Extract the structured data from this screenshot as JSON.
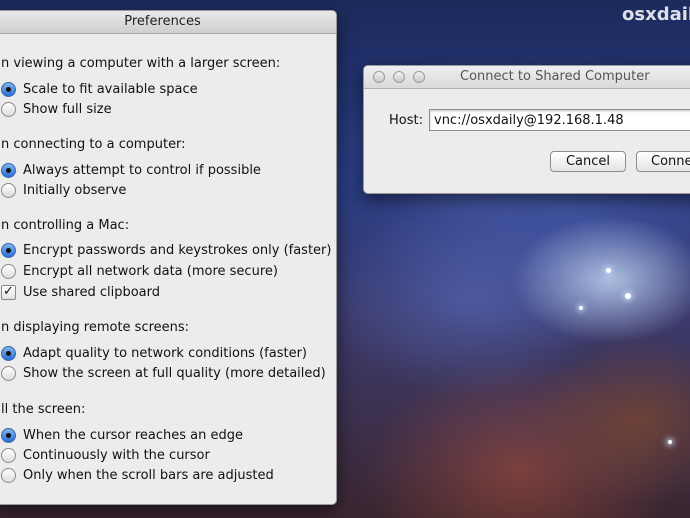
{
  "watermark": "osxdail",
  "preferences": {
    "title": "Preferences",
    "sections": [
      {
        "heading": "n viewing a computer with a larger screen:",
        "options": [
          {
            "label": "Scale to fit available space",
            "type": "radio",
            "checked": true
          },
          {
            "label": "Show full size",
            "type": "radio",
            "checked": false
          }
        ]
      },
      {
        "heading": "n connecting to a computer:",
        "options": [
          {
            "label": "Always attempt to control if possible",
            "type": "radio",
            "checked": true
          },
          {
            "label": "Initially observe",
            "type": "radio",
            "checked": false
          }
        ]
      },
      {
        "heading": "n controlling a Mac:",
        "options": [
          {
            "label": "Encrypt passwords and keystrokes only (faster)",
            "type": "radio",
            "checked": true
          },
          {
            "label": "Encrypt all network data (more secure)",
            "type": "radio",
            "checked": false
          },
          {
            "label": "Use shared clipboard",
            "type": "checkbox",
            "checked": true
          }
        ]
      },
      {
        "heading": "n displaying remote screens:",
        "options": [
          {
            "label": "Adapt quality to network conditions (faster)",
            "type": "radio",
            "checked": true
          },
          {
            "label": "Show the screen at full quality (more detailed)",
            "type": "radio",
            "checked": false
          }
        ]
      },
      {
        "heading": "ll the screen:",
        "options": [
          {
            "label": "When the cursor reaches an edge",
            "type": "radio",
            "checked": true
          },
          {
            "label": "Continuously with the cursor",
            "type": "radio",
            "checked": false
          },
          {
            "label": "Only when the scroll bars are adjusted",
            "type": "radio",
            "checked": false
          }
        ]
      }
    ]
  },
  "connect": {
    "title": "Connect to Shared Computer",
    "host_label": "Host:",
    "host_value": "vnc://osxdaily@192.168.1.48",
    "cancel_label": "Cancel",
    "connect_label": "Conne"
  }
}
